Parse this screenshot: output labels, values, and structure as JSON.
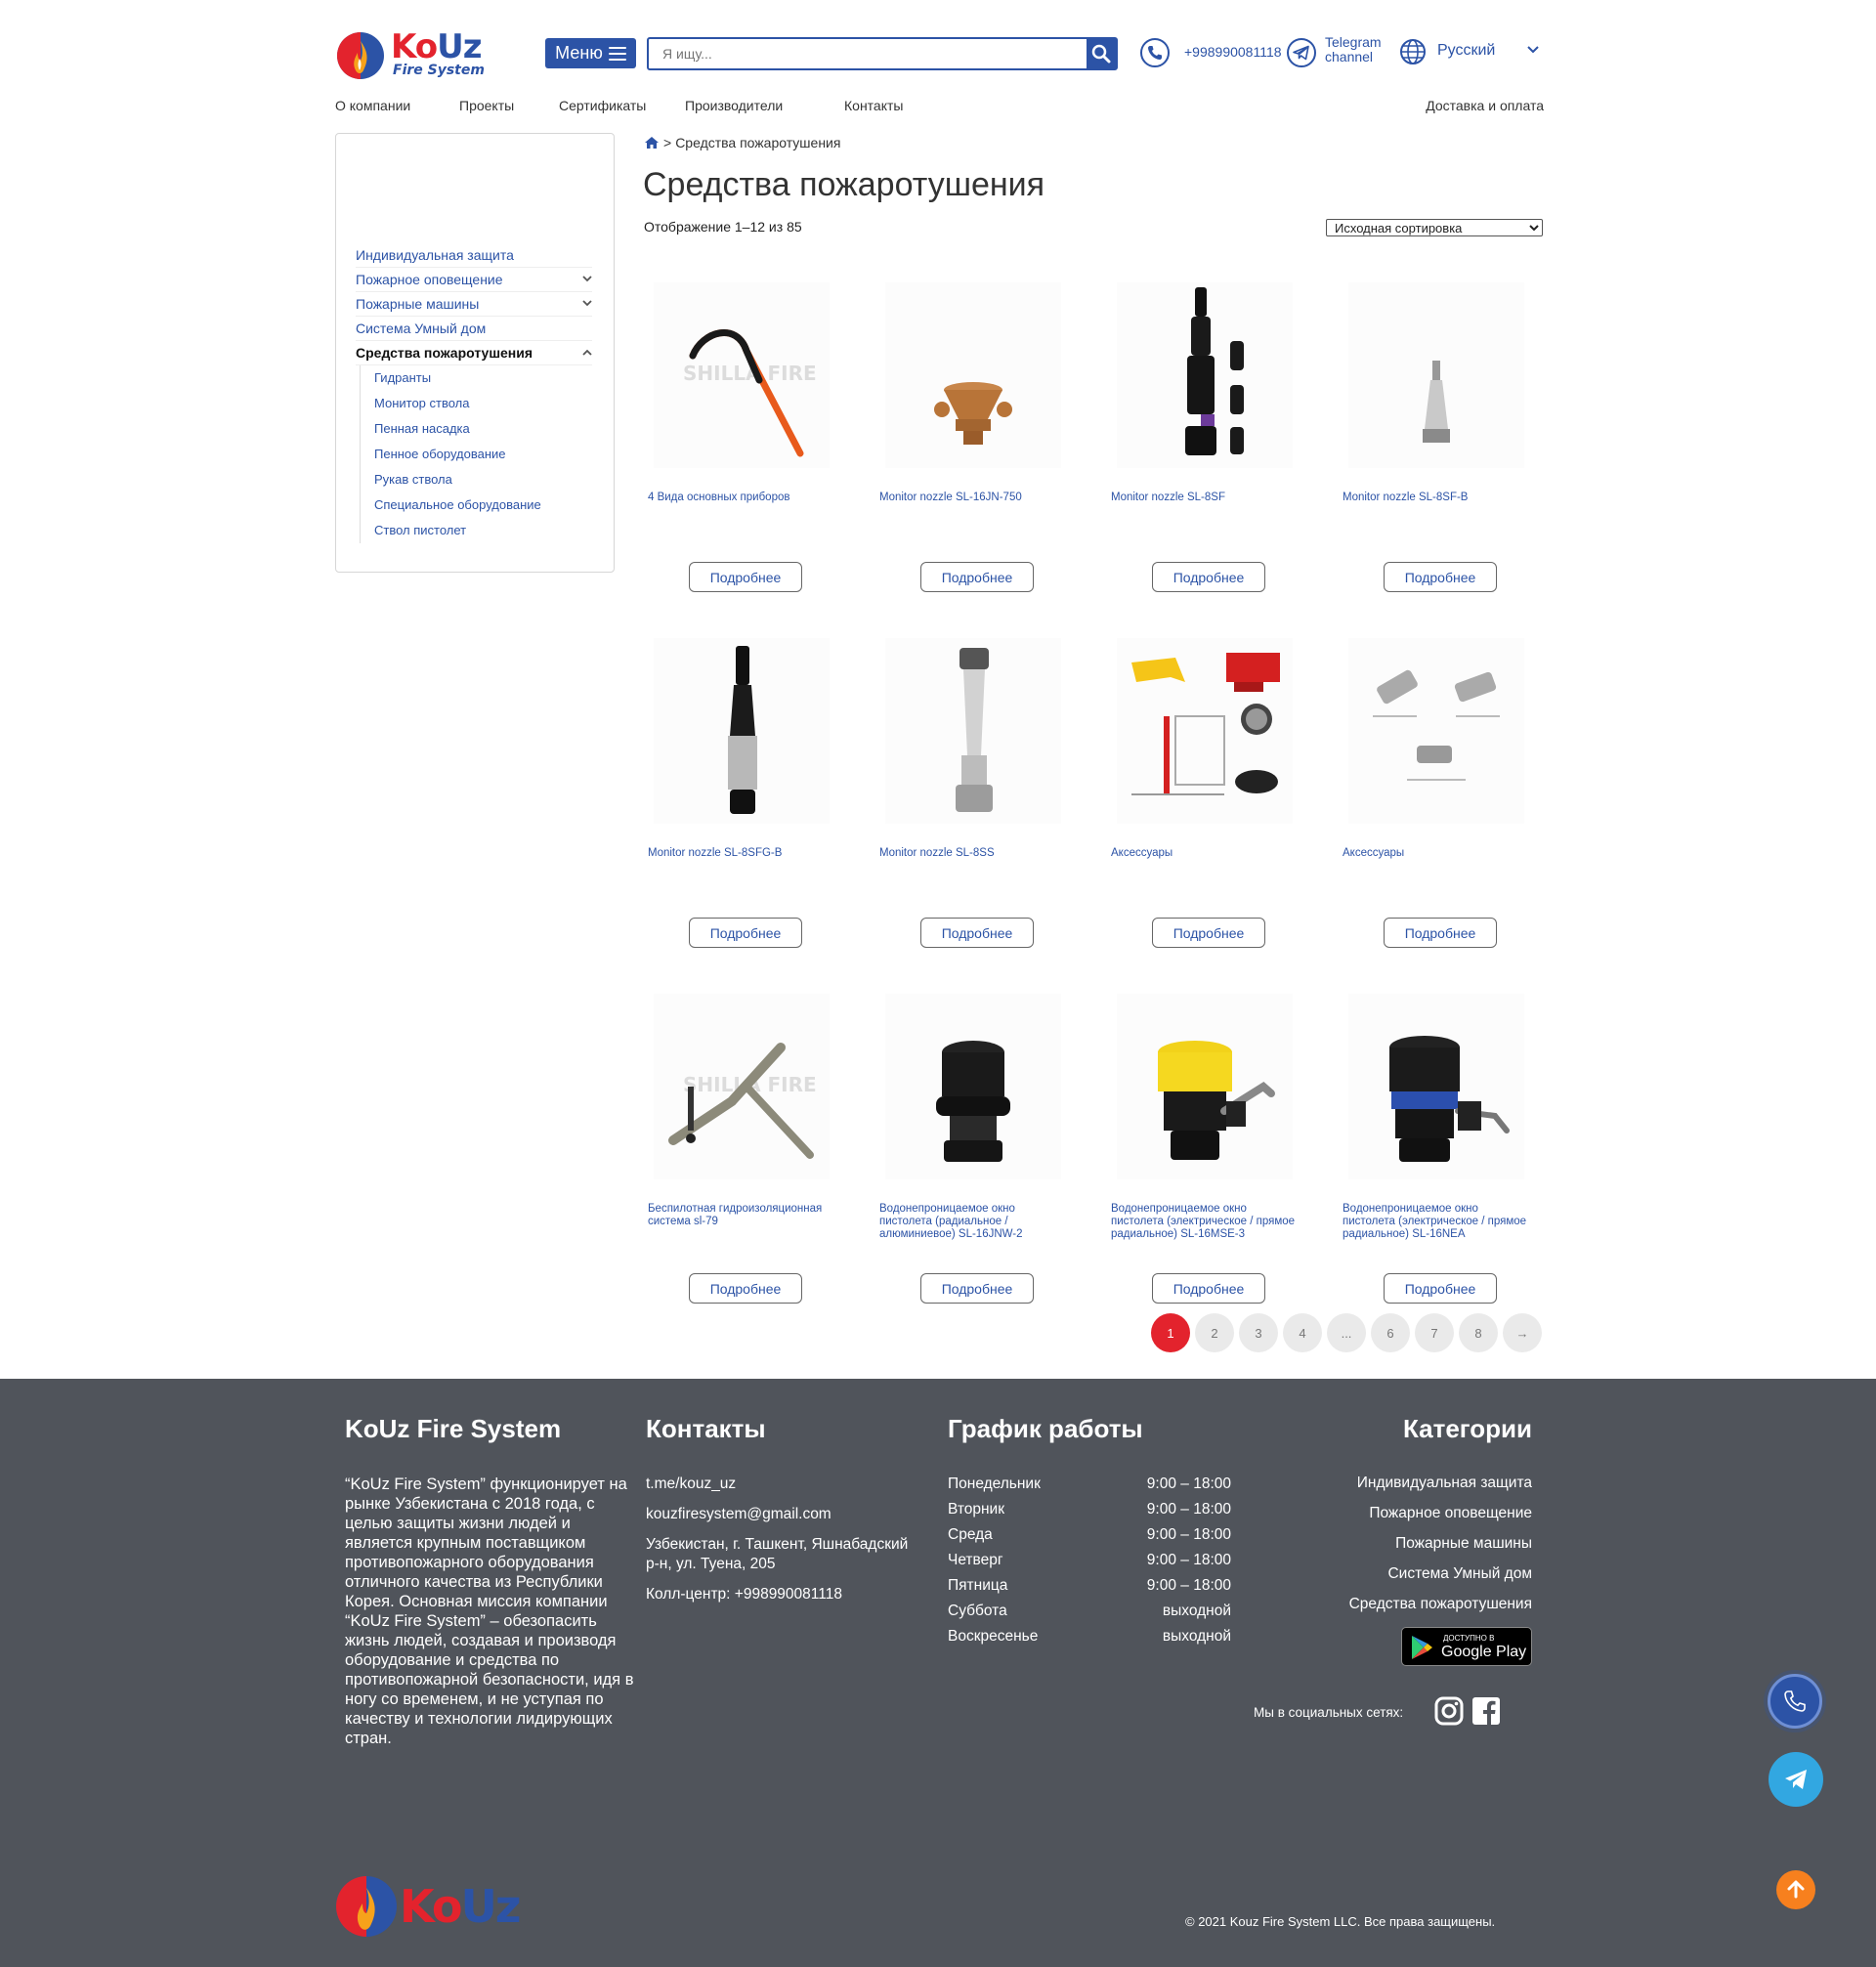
{
  "header": {
    "logo_ko": "Ko",
    "logo_uz": "Uz",
    "logo_sub": "Fire System",
    "menu_label": "Меню",
    "search_placeholder": "Я ищу...",
    "phone": "+998990081118",
    "telegram_line1": "Telegram",
    "telegram_line2": "channel",
    "language": "Русский"
  },
  "nav": {
    "items": [
      "О компании",
      "Проекты",
      "Сертификаты",
      "Производители",
      "Контакты"
    ],
    "right": "Доставка и оплата"
  },
  "sidebar": {
    "categories": [
      {
        "label": "Индивидуальная защита",
        "expandable": false
      },
      {
        "label": "Пожарное оповещение",
        "expandable": true
      },
      {
        "label": "Пожарные машины",
        "expandable": true
      },
      {
        "label": "Система Умный дом",
        "expandable": false
      },
      {
        "label": "Средства пожаротушения",
        "expandable": true,
        "active": true
      }
    ],
    "subcategories": [
      "Гидранты",
      "Монитор ствола",
      "Пенная насадка",
      "Пенное оборудование",
      "Рукав ствола",
      "Специальное оборудование",
      "Ствол пистолет"
    ]
  },
  "main": {
    "breadcrumb": "Средства пожаротушения",
    "title": "Средства пожаротушения",
    "result_count": "Отображение 1–12 из 85",
    "sort_selected": "Исходная сортировка",
    "more_label": "Подробнее",
    "products": [
      {
        "title": "4 Вида основных приборов",
        "image": "hook-tool",
        "watermark": "SHILLA FIRE"
      },
      {
        "title": "Monitor nozzle SL-16JN-750",
        "image": "bronze-nozzle"
      },
      {
        "title": "Monitor nozzle SL-8SF",
        "image": "black-nozzle-set"
      },
      {
        "title": "Monitor nozzle SL-8SF-B",
        "image": "chrome-cone-nozzle"
      },
      {
        "title": "Monitor nozzle SL-8SFG-B",
        "image": "black-chrome-nozzle"
      },
      {
        "title": "Monitor nozzle SL-8SS",
        "image": "chrome-nozzle"
      },
      {
        "title": "Аксессуары",
        "image": "accessories-diagram"
      },
      {
        "title": "Аксессуары",
        "image": "valve-accessories"
      },
      {
        "title": "Беспилотная гидроизоляционная система sl-79",
        "image": "unmanned-monitor",
        "watermark": "SHILLA FIRE"
      },
      {
        "title": "Водонепроницаемое окно пистолета (радиальное / алюминиевое) SL-16JNW-2",
        "image": "black-fog-nozzle"
      },
      {
        "title": "Водонепроницаемое окно пистолета (электрическое / прямое радиальное) SL-16MSE-3",
        "image": "yellow-electric-nozzle"
      },
      {
        "title": "Водонепроницаемое окно пистолета (электрическое / прямое радиальное) SL-16NEA",
        "image": "blue-electric-nozzle"
      }
    ]
  },
  "pagination": [
    "1",
    "2",
    "3",
    "4",
    "...",
    "6",
    "7",
    "8",
    "→"
  ],
  "footer": {
    "about_title": "KoUz Fire System",
    "about_text": "“KoUz Fire System” функционирует на рынке Узбекистана с 2018 года, с целью защиты жизни людей и является крупным поставщиком противопожарного оборудования отличного качества из Республики Корея. Основная миссия компании “KoUz Fire System” – обезопасить жизнь людей, создавая и производя оборудование и средства по противопожарной безопасности, идя в ногу со временем, и не уступая по качеству и технологии лидирующих стран.",
    "contacts_title": "Контакты",
    "contacts": [
      "t.me/kouz_uz",
      "kouzfiresystem@gmail.com",
      "Узбекистан, г. Ташкент, Яшнабадский р-н, ул. Туена, 205",
      "Колл-центр: +998990081118"
    ],
    "schedule_title": "График работы",
    "schedule": [
      {
        "day": "Понедельник",
        "hours": "9:00 – 18:00"
      },
      {
        "day": "Вторник",
        "hours": "9:00 – 18:00"
      },
      {
        "day": "Среда",
        "hours": "9:00 – 18:00"
      },
      {
        "day": "Четверг",
        "hours": "9:00 – 18:00"
      },
      {
        "day": "Пятница",
        "hours": "9:00 – 18:00"
      },
      {
        "day": "Суббота",
        "hours": "выходной"
      },
      {
        "day": "Воскресенье",
        "hours": "выходной"
      }
    ],
    "categories_title": "Категории",
    "categories": [
      "Индивидуальная защита",
      "Пожарное оповещение",
      "Пожарные машины",
      "Система Умный дом",
      "Средства пожаротушения"
    ],
    "gplay_small": "ДОСТУПНО В",
    "gplay_big": "Google Play",
    "social_label": "Мы в социальных сетях:",
    "copyright": "© 2021 Kouz Fire System LLC. Все права защищены."
  },
  "colors": {
    "brand_blue": "#2c53a6",
    "brand_red": "#e3232d",
    "footer_bg": "#50545b",
    "scroll_top": "#f7801e",
    "telegram": "#32a7e1"
  }
}
